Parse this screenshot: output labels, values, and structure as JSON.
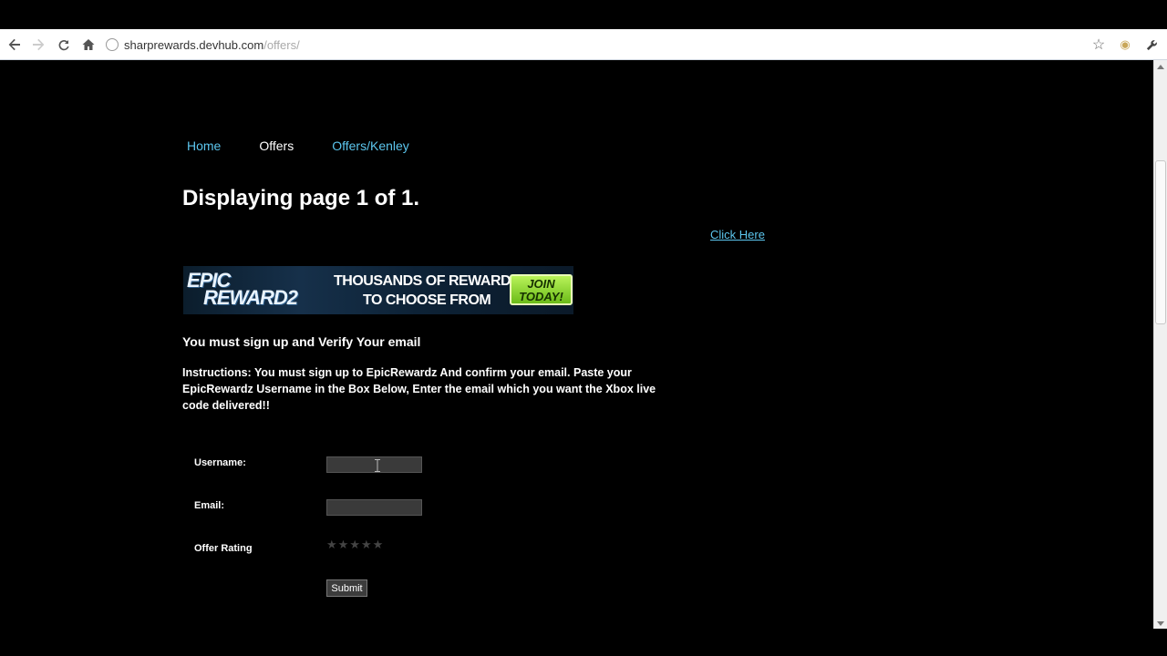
{
  "browser": {
    "url_host": "sharprewards.devhub.com",
    "url_path": "/offers/"
  },
  "nav": {
    "home": "Home",
    "offers": "Offers",
    "kenley": "Offers/Kenley"
  },
  "page": {
    "title": "Displaying page 1 of 1.",
    "click_here": "Click Here",
    "subhead": "You must sign up and Verify Your email",
    "instructions": "Instructions: You must sign up to EpicRewardz And confirm your email. Paste your EpicRewardz Username in the Box Below, Enter the email which you want the Xbox live code delivered!!"
  },
  "banner": {
    "logo_line1": "EPIC",
    "logo_line2": "REWARD2",
    "tagline_line1": "THOUSANDS OF REWARDS",
    "tagline_line2": "TO CHOOSE FROM",
    "join_line1": "JOIN",
    "join_line2": "TODAY!"
  },
  "form": {
    "username_label": "Username:",
    "username_value": "",
    "email_label": "Email:",
    "email_value": "",
    "rating_label": "Offer Rating",
    "rating_value": 0,
    "rating_max": 5,
    "submit_label": "Submit"
  },
  "colors": {
    "link": "#5cc6ee",
    "background": "#000000",
    "text": "#ffffff"
  }
}
